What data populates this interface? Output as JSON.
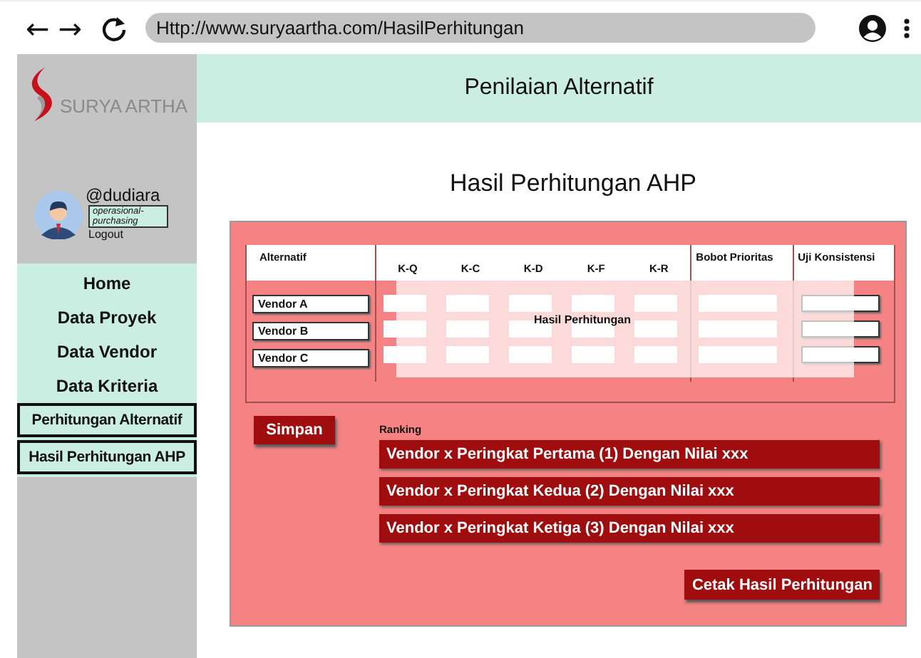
{
  "browser": {
    "back": "←",
    "forward": "→",
    "url": "Http://www.suryaartha.com/HasilPerhitungan"
  },
  "sidebar": {
    "logo": "SURYA ARTHA",
    "user": {
      "name": "@dudiara",
      "role": "operasional-purchasing",
      "logout": "Logout"
    },
    "items": [
      {
        "label": "Home",
        "selected": false
      },
      {
        "label": "Data Proyek",
        "selected": false
      },
      {
        "label": "Data Vendor",
        "selected": false
      },
      {
        "label": "Data Kriteria",
        "selected": false
      },
      {
        "label": "Perhitungan Alternatif",
        "selected": true
      },
      {
        "label": "Hasil Perhitungan AHP",
        "selected": true
      }
    ]
  },
  "header": {
    "title": "Penilaian Alternatif"
  },
  "page_title": "Hasil Perhitungan AHP",
  "table": {
    "columns": [
      "Alternatif",
      "K-Q",
      "K-C",
      "K-D",
      "K-F",
      "K-R",
      "Bobot Prioritas",
      "Uji Konsistensi"
    ],
    "rows": [
      {
        "alternative": "Vendor A"
      },
      {
        "alternative": "Vendor B"
      },
      {
        "alternative": "Vendor C"
      }
    ],
    "overlay": "Hasil Perhitungan"
  },
  "save_button": "Simpan",
  "ranking": {
    "label": "Ranking",
    "items": [
      "Vendor x Peringkat Pertama (1) Dengan Nilai xxx",
      "Vendor x Peringkat Kedua (2) Dengan Nilai xxx",
      "Vendor x Peringkat Ketiga (3) Dengan Nilai xxx"
    ]
  },
  "print_button": "Cetak Hasil Perhitungan"
}
